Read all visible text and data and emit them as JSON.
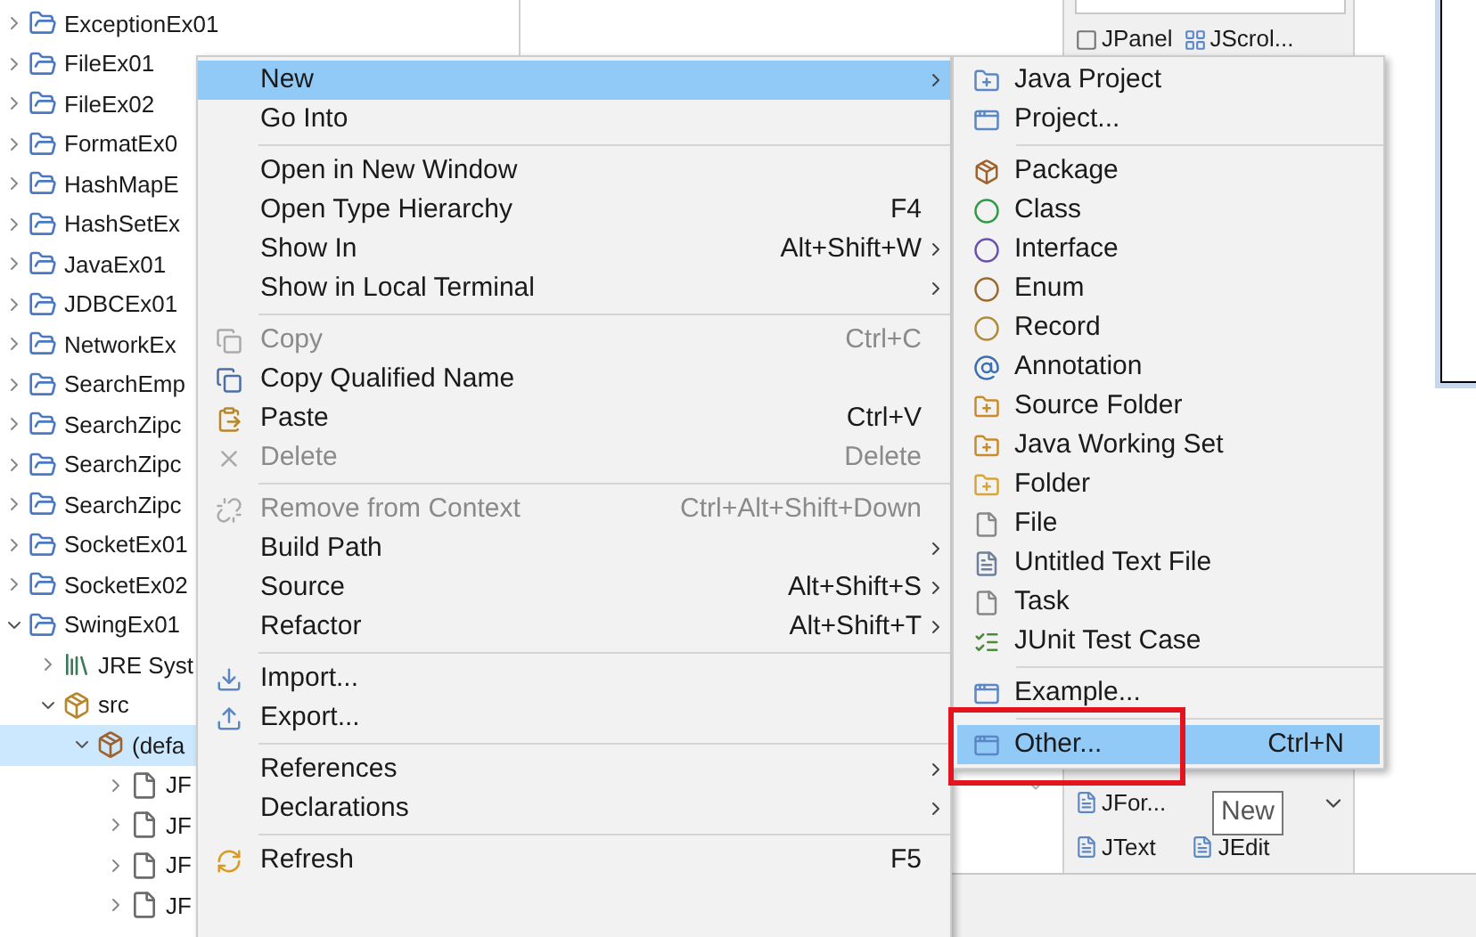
{
  "project_tree": {
    "items": [
      {
        "label": "ExceptionEx01",
        "expanded": false,
        "selected": false
      },
      {
        "label": "FileEx01",
        "expanded": false,
        "selected": false
      },
      {
        "label": "FileEx02",
        "expanded": false,
        "selected": false
      },
      {
        "label": "FormatEx0",
        "expanded": false,
        "selected": false
      },
      {
        "label": "HashMapE",
        "expanded": false,
        "selected": false
      },
      {
        "label": "HashSetEx",
        "expanded": false,
        "selected": false
      },
      {
        "label": "JavaEx01",
        "expanded": false,
        "selected": false
      },
      {
        "label": "JDBCEx01",
        "expanded": false,
        "selected": false
      },
      {
        "label": "NetworkEx",
        "expanded": false,
        "selected": false
      },
      {
        "label": "SearchEmp",
        "expanded": false,
        "selected": false
      },
      {
        "label": "SearchZipc",
        "expanded": false,
        "selected": false
      },
      {
        "label": "SearchZipc",
        "expanded": false,
        "selected": false
      },
      {
        "label": "SearchZipc",
        "expanded": false,
        "selected": false
      },
      {
        "label": "SocketEx01",
        "expanded": false,
        "selected": false
      },
      {
        "label": "SocketEx02",
        "expanded": false,
        "selected": false
      },
      {
        "label": "SwingEx01",
        "expanded": true,
        "selected": false,
        "children": [
          {
            "label": "JRE Syst",
            "expanded": false,
            "selected": false
          },
          {
            "label": "src",
            "expanded": true,
            "selected": false,
            "children": [
              {
                "label": "(defa",
                "expanded": true,
                "selected": true,
                "children": [
                  {
                    "label": "JF",
                    "expanded": false,
                    "selected": false
                  },
                  {
                    "label": "JF",
                    "expanded": false,
                    "selected": false
                  },
                  {
                    "label": "JF",
                    "expanded": false,
                    "selected": false
                  },
                  {
                    "label": "JF",
                    "expanded": false,
                    "selected": false
                  }
                ]
              }
            ]
          }
        ]
      }
    ]
  },
  "palette": {
    "top_row": [
      "JPanel",
      "JScrol..."
    ],
    "bottom_rows": [
      [
        "JFor..."
      ],
      [
        "JText",
        "JEdit"
      ]
    ]
  },
  "context_menu": {
    "items": [
      {
        "kind": "item",
        "label": "New",
        "submenu": true,
        "disabled": false,
        "selected": true
      },
      {
        "kind": "item",
        "label": "Go Into",
        "submenu": false,
        "disabled": false,
        "selected": false
      },
      {
        "kind": "separator"
      },
      {
        "kind": "item",
        "label": "Open in New Window",
        "submenu": false,
        "disabled": false,
        "selected": false
      },
      {
        "kind": "item",
        "label": "Open Type Hierarchy",
        "shortcut": "F4",
        "submenu": false,
        "disabled": false,
        "selected": false
      },
      {
        "kind": "item",
        "label": "Show In",
        "shortcut": "Alt+Shift+W",
        "submenu": true,
        "disabled": false,
        "selected": false
      },
      {
        "kind": "item",
        "label": "Show in Local Terminal",
        "submenu": true,
        "disabled": false,
        "selected": false
      },
      {
        "kind": "separator"
      },
      {
        "kind": "item",
        "label": "Copy",
        "shortcut": "Ctrl+C",
        "submenu": false,
        "disabled": true,
        "selected": false
      },
      {
        "kind": "item",
        "label": "Copy Qualified Name",
        "submenu": false,
        "disabled": false,
        "selected": false
      },
      {
        "kind": "item",
        "label": "Paste",
        "shortcut": "Ctrl+V",
        "submenu": false,
        "disabled": false,
        "selected": false
      },
      {
        "kind": "item",
        "label": "Delete",
        "shortcut": "Delete",
        "submenu": false,
        "disabled": true,
        "selected": false
      },
      {
        "kind": "separator"
      },
      {
        "kind": "item",
        "label": "Remove from Context",
        "shortcut": "Ctrl+Alt+Shift+Down",
        "submenu": false,
        "disabled": true,
        "selected": false
      },
      {
        "kind": "item",
        "label": "Build Path",
        "submenu": true,
        "disabled": false,
        "selected": false
      },
      {
        "kind": "item",
        "label": "Source",
        "shortcut": "Alt+Shift+S",
        "submenu": true,
        "disabled": false,
        "selected": false
      },
      {
        "kind": "item",
        "label": "Refactor",
        "shortcut": "Alt+Shift+T",
        "submenu": true,
        "disabled": false,
        "selected": false
      },
      {
        "kind": "separator"
      },
      {
        "kind": "item",
        "label": "Import...",
        "submenu": false,
        "disabled": false,
        "selected": false
      },
      {
        "kind": "item",
        "label": "Export...",
        "submenu": false,
        "disabled": false,
        "selected": false
      },
      {
        "kind": "separator"
      },
      {
        "kind": "item",
        "label": "References",
        "submenu": true,
        "disabled": false,
        "selected": false
      },
      {
        "kind": "item",
        "label": "Declarations",
        "submenu": true,
        "disabled": false,
        "selected": false
      },
      {
        "kind": "separator"
      },
      {
        "kind": "item",
        "label": "Refresh",
        "shortcut": "F5",
        "submenu": false,
        "disabled": false,
        "selected": false
      }
    ]
  },
  "new_submenu": {
    "items": [
      {
        "kind": "item",
        "label": "Java Project",
        "selected": false
      },
      {
        "kind": "item",
        "label": "Project...",
        "selected": false
      },
      {
        "kind": "separator"
      },
      {
        "kind": "item",
        "label": "Package",
        "selected": false
      },
      {
        "kind": "item",
        "label": "Class",
        "selected": false
      },
      {
        "kind": "item",
        "label": "Interface",
        "selected": false
      },
      {
        "kind": "item",
        "label": "Enum",
        "selected": false
      },
      {
        "kind": "item",
        "label": "Record",
        "selected": false
      },
      {
        "kind": "item",
        "label": "Annotation",
        "selected": false
      },
      {
        "kind": "item",
        "label": "Source Folder",
        "selected": false
      },
      {
        "kind": "item",
        "label": "Java Working Set",
        "selected": false
      },
      {
        "kind": "item",
        "label": "Folder",
        "selected": false
      },
      {
        "kind": "item",
        "label": "File",
        "selected": false
      },
      {
        "kind": "item",
        "label": "Untitled Text File",
        "selected": false
      },
      {
        "kind": "item",
        "label": "Task",
        "selected": false
      },
      {
        "kind": "item",
        "label": "JUnit Test Case",
        "selected": false
      },
      {
        "kind": "separator"
      },
      {
        "kind": "item",
        "label": "Example...",
        "selected": false
      },
      {
        "kind": "separator"
      },
      {
        "kind": "item",
        "label": "Other...",
        "shortcut": "Ctrl+N",
        "selected": true
      }
    ]
  },
  "tooltip": {
    "text": "New"
  }
}
